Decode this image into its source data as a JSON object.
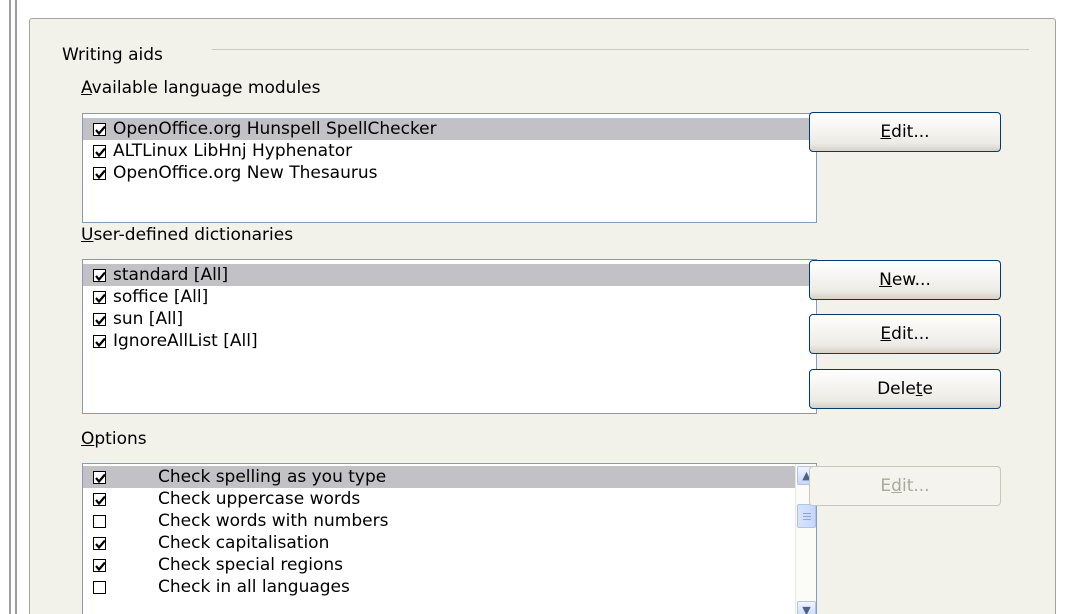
{
  "writing_aids": {
    "title": "Writing aids",
    "modules": {
      "label_first": "A",
      "label_rest": "vailable language modules",
      "items": [
        {
          "label": "OpenOffice.org Hunspell SpellChecker",
          "checked": true,
          "selected": true
        },
        {
          "label": "ALTLinux LibHnj Hyphenator",
          "checked": true,
          "selected": false
        },
        {
          "label": "OpenOffice.org New Thesaurus",
          "checked": true,
          "selected": false
        }
      ],
      "edit_button": {
        "first": "E",
        "rest": "dit..."
      }
    },
    "dictionaries": {
      "label_first": "U",
      "label_rest": "ser-defined dictionaries",
      "items": [
        {
          "label": "standard [All]",
          "checked": true,
          "selected": true
        },
        {
          "label": "soffice [All]",
          "checked": true,
          "selected": false
        },
        {
          "label": "sun [All]",
          "checked": true,
          "selected": false
        },
        {
          "label": "IgnoreAllList [All]",
          "checked": true,
          "selected": false
        }
      ],
      "new_button": {
        "first": "N",
        "rest": "ew..."
      },
      "edit_button": {
        "first": "E",
        "rest": "dit..."
      },
      "delete_button": {
        "before": "Dele",
        "u": "t",
        "after": "e"
      }
    },
    "options": {
      "label_first": "O",
      "label_rest": "ptions",
      "items": [
        {
          "label": "Check spelling as you type",
          "checked": true,
          "selected": true
        },
        {
          "label": "Check uppercase words",
          "checked": true,
          "selected": false
        },
        {
          "label": "Check words with numbers",
          "checked": false,
          "selected": false
        },
        {
          "label": "Check capitalisation",
          "checked": true,
          "selected": false
        },
        {
          "label": "Check special regions",
          "checked": true,
          "selected": false
        },
        {
          "label": "Check in all languages",
          "checked": false,
          "selected": false
        }
      ],
      "edit_button": {
        "before": "E",
        "u": "d",
        "after": "it..."
      }
    }
  }
}
